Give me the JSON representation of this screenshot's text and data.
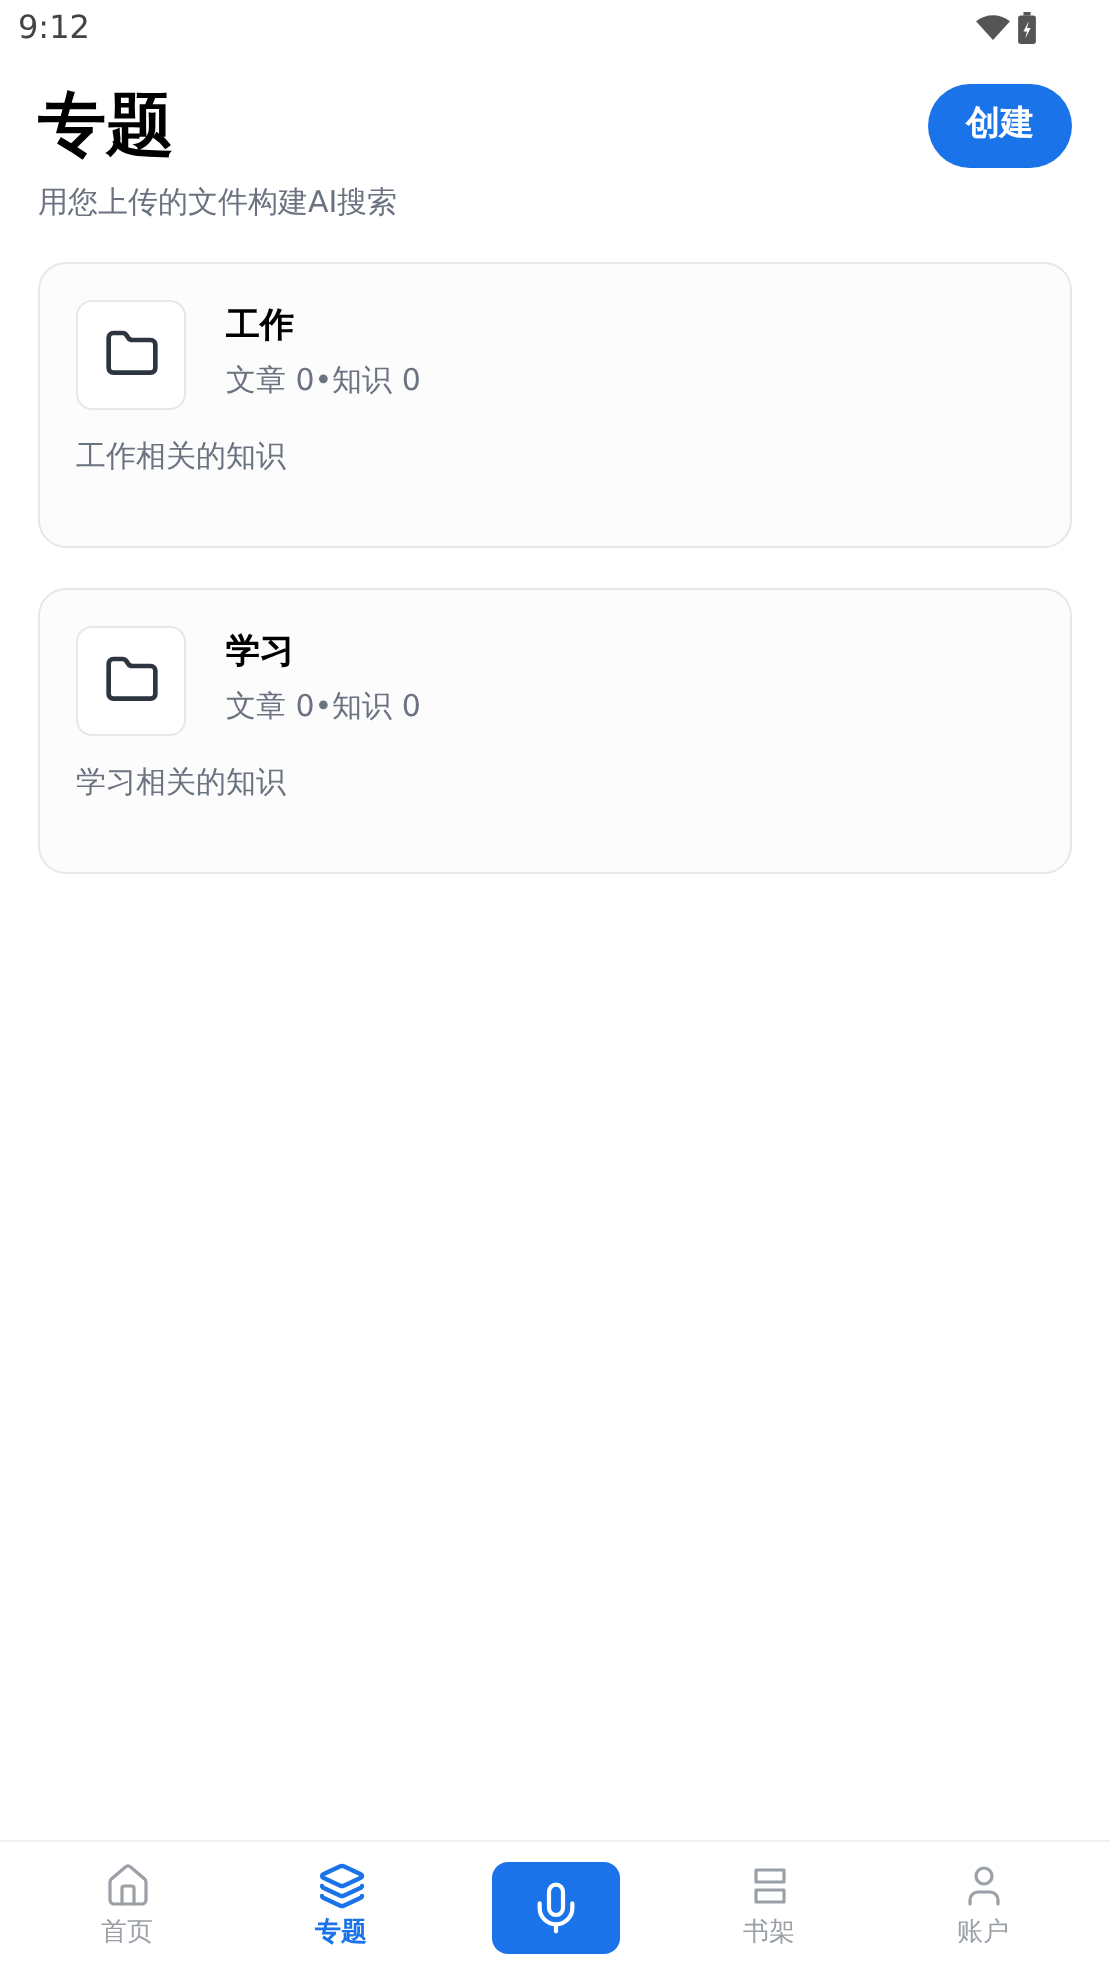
{
  "status_bar": {
    "time": "9:12"
  },
  "header": {
    "title": "专题",
    "subtitle": "用您上传的文件构建AI搜索",
    "create_button": "创建"
  },
  "topics": [
    {
      "name": "工作",
      "stats": "文章 0•知识 0",
      "description": "工作相关的知识"
    },
    {
      "name": "学习",
      "stats": "文章 0•知识 0",
      "description": "学习相关的知识"
    }
  ],
  "bottom_nav": [
    {
      "kind": "home",
      "label": "首页",
      "selected": false
    },
    {
      "kind": "layers",
      "label": "专题",
      "selected": true
    },
    {
      "kind": "mic"
    },
    {
      "kind": "shelf",
      "label": "书架",
      "selected": false
    },
    {
      "kind": "user",
      "label": "账户",
      "selected": false
    }
  ]
}
